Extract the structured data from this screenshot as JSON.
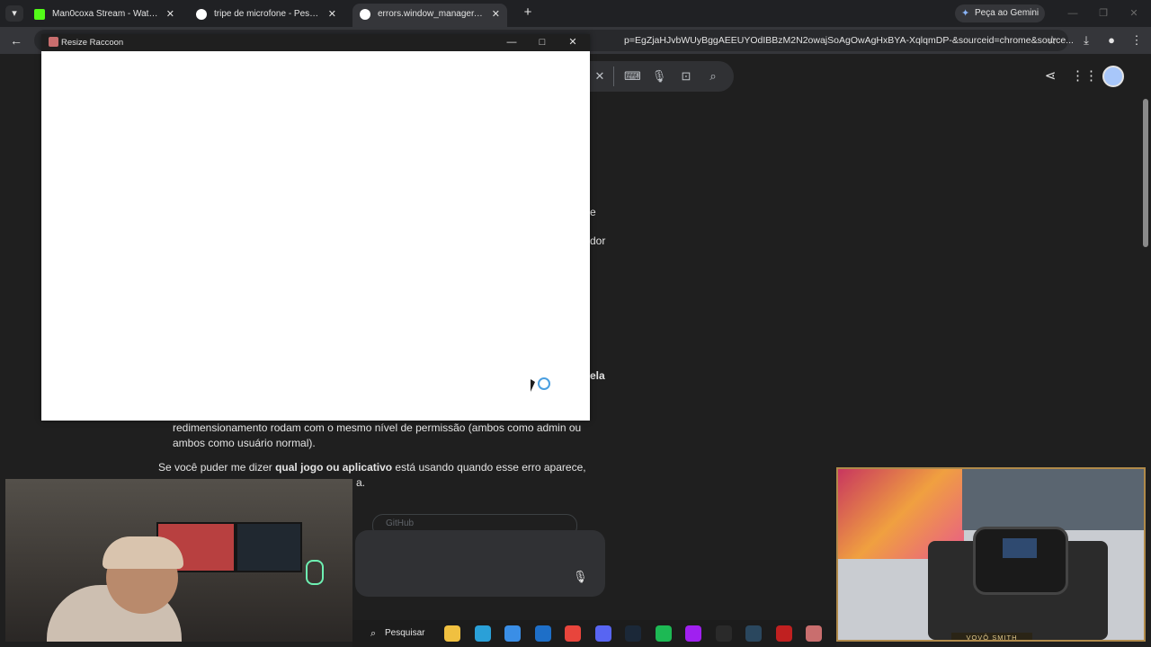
{
  "tabs": [
    {
      "title": "Man0coxa Stream - Watch Live",
      "favicon_color": "#53fc18",
      "active": false
    },
    {
      "title": "tripe de microfone - Pesquisa G",
      "favicon_color": "#4285f4",
      "active": false
    },
    {
      "title": "errors.window_manager.access",
      "favicon_color": "#4285f4",
      "active": true
    }
  ],
  "browser": {
    "gemini_label": "Peça ao Gemini",
    "url_visible": "p=EgZjaHJvbWUyBggAEEUYOdIBBzM2N2owajSoAgOwAgHxBYA-XqlqmDP-&sourceid=chrome&source..."
  },
  "resize_window": {
    "title": "Resize Raccoon"
  },
  "page": {
    "fragment_e": "e",
    "fragment_dor": "dor",
    "fragment_ela": "ela",
    "para1": "redimensionamento rodam com o mesmo nível de permissão (ambos como admin ou ambos como usuário normal).",
    "para2_pre": "Se você puder me dizer ",
    "para2_bold": "qual jogo ou aplicativo",
    "para2_post": " está usando quando esse erro aparece,",
    "para3_tail": "a.",
    "source_card_label": "GitHub"
  },
  "taskbar": {
    "search_label": "Pesquisar",
    "apps": [
      {
        "name": "file-explorer-icon",
        "color": "#f0c040"
      },
      {
        "name": "edge-icon",
        "color": "#2aa0d8"
      },
      {
        "name": "store-icon",
        "color": "#3a8ee6"
      },
      {
        "name": "outlook-icon",
        "color": "#1e6fc8"
      },
      {
        "name": "chrome-icon",
        "color": "#e8453c"
      },
      {
        "name": "discord-icon",
        "color": "#5865f2"
      },
      {
        "name": "steam-icon",
        "color": "#1b2838"
      },
      {
        "name": "spotify-icon",
        "color": "#1db954"
      },
      {
        "name": "app-icon-purple",
        "color": "#a020f0"
      },
      {
        "name": "app-icon-green",
        "color": "#2a2a2a"
      },
      {
        "name": "steam-icon-2",
        "color": "#2a475e"
      },
      {
        "name": "app-icon-red",
        "color": "#c02020"
      },
      {
        "name": "raccoon-app-icon",
        "color": "#c96e6e"
      }
    ]
  },
  "overlay": {
    "cam2_label": "VOVÔ SMITH"
  }
}
